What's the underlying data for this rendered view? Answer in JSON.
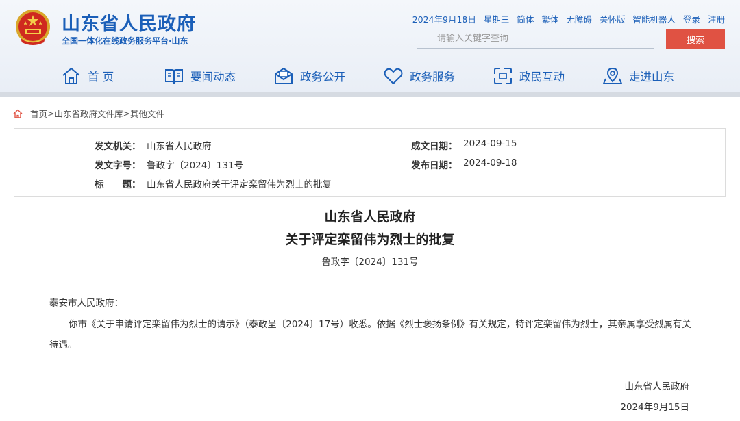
{
  "header": {
    "site_title": "山东省人民政府",
    "site_subtitle": "全国一体化在线政务服务平台·山东",
    "brand_color": "#1b5fb8",
    "accent_color": "#e05243",
    "top_links": {
      "date": "2024年9月18日",
      "weekday": "星期三",
      "simplified": "简体",
      "traditional": "繁体",
      "accessible": "无障碍",
      "elderly": "关怀版",
      "robot": "智能机器人",
      "login": "登录",
      "register": "注册"
    },
    "search": {
      "placeholder": "请输入关键字查询",
      "button": "搜索"
    }
  },
  "nav": {
    "items": [
      {
        "label": "首 页",
        "icon": "home-icon"
      },
      {
        "label": "要闻动态",
        "icon": "book-icon"
      },
      {
        "label": "政务公开",
        "icon": "mail-icon"
      },
      {
        "label": "政务服务",
        "icon": "heart-icon"
      },
      {
        "label": "政民互动",
        "icon": "interact-icon"
      },
      {
        "label": "走进山东",
        "icon": "location-icon"
      }
    ]
  },
  "breadcrumb": {
    "icon": "home-icon",
    "home": "首页",
    "sep": ">",
    "library": "山东省政府文件库",
    "current": "其他文件"
  },
  "meta": {
    "issuer_label": "发文机关：",
    "issuer": "山东省人民政府",
    "doc_no_label": "发文字号：",
    "doc_no": "鲁政字〔2024〕131号",
    "title_label": "标　　题：",
    "title": "山东省人民政府关于评定栾留伟为烈士的批复",
    "written_label": "成文日期：",
    "written": "2024-09-15",
    "published_label": "发布日期：",
    "published": "2024-09-18"
  },
  "document": {
    "heading_line1": "山东省人民政府",
    "heading_line2": "关于评定栾留伟为烈士的批复",
    "number": "鲁政字〔2024〕131号",
    "addressee": "泰安市人民政府：",
    "body": "你市《关于申请评定栾留伟为烈士的请示》（泰政呈〔2024〕17号）收悉。依据《烈士褒扬条例》有关规定，特评定栾留伟为烈士，其亲属享受烈属有关待遇。",
    "signature_org": "山东省人民政府",
    "signature_date": "2024年9月15日"
  }
}
